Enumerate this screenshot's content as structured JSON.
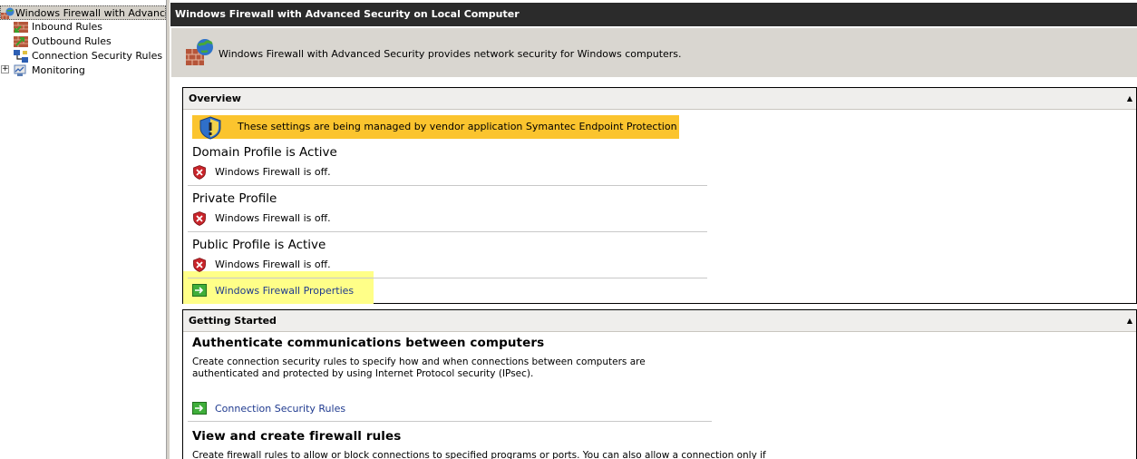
{
  "tree": {
    "root": "Windows Firewall with Advanced S",
    "items": [
      {
        "label": "Inbound Rules"
      },
      {
        "label": "Outbound Rules"
      },
      {
        "label": "Connection Security Rules"
      },
      {
        "label": "Monitoring"
      }
    ],
    "expander": "+"
  },
  "header": {
    "title": "Windows Firewall with Advanced Security on Local Computer"
  },
  "banner": {
    "text": "Windows Firewall with Advanced Security provides network security for Windows computers."
  },
  "overview": {
    "heading": "Overview",
    "collapse": "▲",
    "warning": "These settings are being managed by vendor application Symantec Endpoint Protection",
    "profiles": [
      {
        "title": "Domain Profile is Active",
        "status": "Windows Firewall is off."
      },
      {
        "title": "Private Profile",
        "status": "Windows Firewall is off."
      },
      {
        "title": "Public Profile is Active",
        "status": "Windows Firewall is off."
      }
    ],
    "properties_link": "Windows Firewall Properties"
  },
  "getting_started": {
    "heading": "Getting Started",
    "collapse": "▲",
    "items": [
      {
        "title": "Authenticate communications between computers",
        "description": "Create connection security rules to specify how and when connections between computers are authenticated and protected by using Internet Protocol security (IPsec).",
        "link": "Connection Security Rules"
      },
      {
        "title": "View and create firewall rules",
        "description": "Create firewall rules to allow or block connections to specified programs or ports. You can also allow a connection only if"
      }
    ]
  },
  "colors": {
    "title_bar": "#2b2b2b",
    "warning_bar": "#fbc42e",
    "highlight": "#ffff88",
    "link": "#1f3a8f"
  }
}
